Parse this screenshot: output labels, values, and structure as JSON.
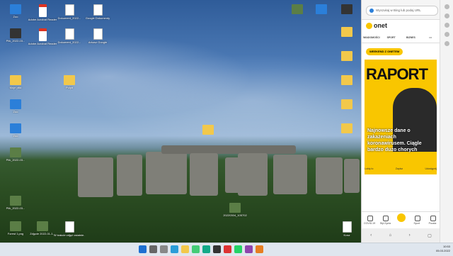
{
  "desktop": {
    "icons": [
      {
        "label": "Zoo",
        "type": "app"
      },
      {
        "label": "Adobe Acrobat Reader",
        "type": "pdf"
      },
      {
        "label": "Dokument_2022...",
        "type": "doc"
      },
      {
        "label": "Google Dokumenty",
        "type": "doc"
      },
      {
        "label": "Plik_2022-03...",
        "type": "doc"
      },
      {
        "label": "Arkusz Google",
        "type": "doc"
      },
      {
        "label": "Moje pliki",
        "type": "fold"
      },
      {
        "label": "Pulpit",
        "type": "fold"
      },
      {
        "label": "Kosz",
        "type": "doc"
      }
    ],
    "taskbar_file": "20220304_105702",
    "bottom_labels": [
      "Forest 1.png",
      "Zdjęcie 2022-01-1...",
      "W trakcie zdjęć ostatnie..."
    ]
  },
  "sidebar": {
    "search_placeholder": "Wyszukaj w Bing lub podaj URL",
    "logo": "onet",
    "tabs": [
      "WIADOMOŚCI",
      "SPORT",
      "BIZNES",
      "•••"
    ],
    "section_pill": "WEEKEND Z ONETEM",
    "hero_title": "RAPORT",
    "headline": "Najnowsze dane o zakażeniach koronawirusem. Ciągle bardzo dużo chorych",
    "actions": [
      "Lubię to",
      "Zapisz",
      "Udostępnij"
    ],
    "bottom_nav": [
      "COVID-19",
      "Styl Życia",
      "",
      "Sport",
      "Poczta"
    ]
  },
  "clock": {
    "time": "10:53",
    "date": "05.03.2022"
  }
}
